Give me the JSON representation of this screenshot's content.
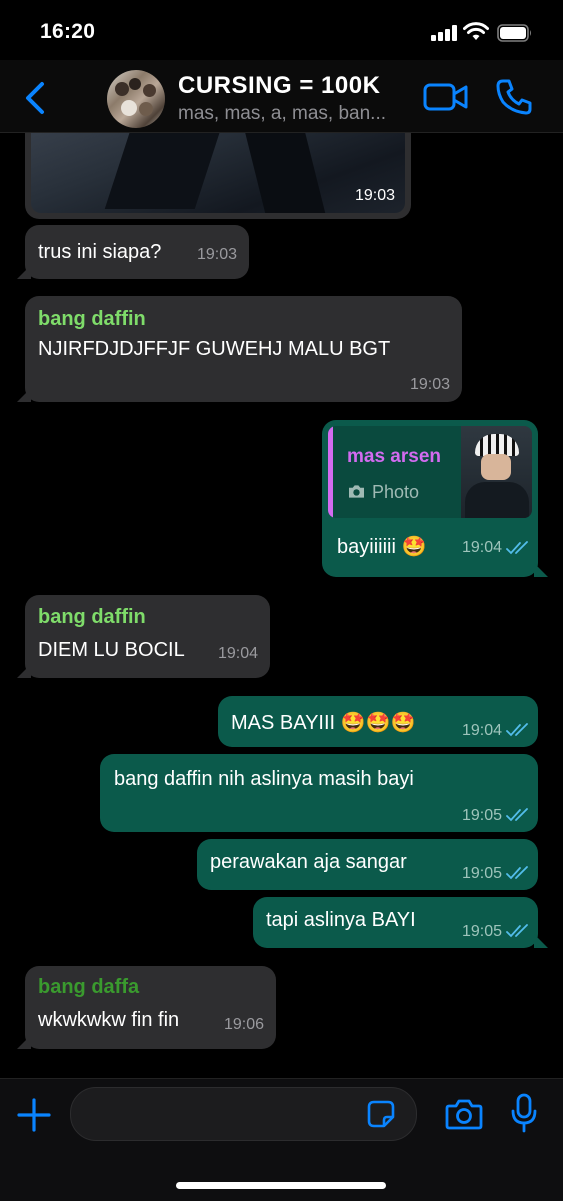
{
  "status_bar": {
    "time": "16:20"
  },
  "header": {
    "title": "CURSING = 100K",
    "subtitle": "mas, mas, a, mas, ban..."
  },
  "messages": [
    {
      "direction": "incoming",
      "kind": "image",
      "time": "19:03"
    },
    {
      "direction": "incoming",
      "text": "trus ini siapa?",
      "time": "19:03"
    },
    {
      "direction": "incoming",
      "sender": "bang daffin",
      "sender_color": "#7fdc6a",
      "text": "NJIRFDJDJFFJF GUWEHJ MALU BGT",
      "time": "19:03"
    },
    {
      "direction": "outgoing",
      "reply_to": {
        "sender": "mas arsen",
        "sender_color": "#d36bf0",
        "label": "Photo"
      },
      "text": "bayiiiiii 🤩",
      "time": "19:04",
      "read": true
    },
    {
      "direction": "incoming",
      "sender": "bang daffin",
      "sender_color": "#7fdc6a",
      "text": "DIEM LU BOCIL",
      "time": "19:04"
    },
    {
      "direction": "outgoing",
      "text": "MAS BAYIII 🤩🤩🤩",
      "time": "19:04",
      "read": true
    },
    {
      "direction": "outgoing",
      "text": "bang daffin nih aslinya masih bayi",
      "time": "19:05",
      "read": true
    },
    {
      "direction": "outgoing",
      "text": "perawakan aja sangar",
      "time": "19:05",
      "read": true
    },
    {
      "direction": "outgoing",
      "text": "tapi aslinya BAYI",
      "time": "19:05",
      "read": true
    },
    {
      "direction": "incoming",
      "sender": "bang daffa",
      "sender_color": "#3a9a2e",
      "text": "wkwkwkw fin fin",
      "time": "19:06"
    }
  ],
  "colors": {
    "accent": "#0a84ff",
    "incoming_bubble": "#2e2e30",
    "outgoing_bubble": "#0b5a4b",
    "read_ticks": "#53bdeb"
  },
  "icons": [
    "back-chevron-icon",
    "video-call-icon",
    "voice-call-icon",
    "plus-icon",
    "sticker-icon",
    "camera-icon",
    "mic-icon",
    "photo-camera-icon",
    "double-check-icon"
  ]
}
